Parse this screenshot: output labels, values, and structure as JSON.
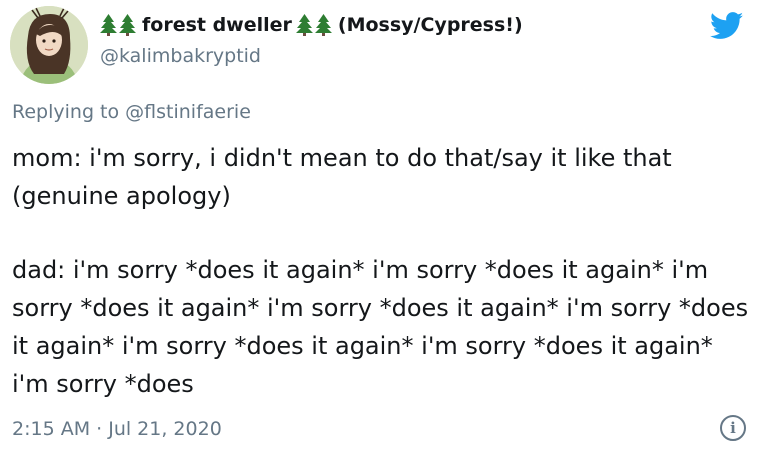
{
  "tweet": {
    "display_name_prefix": "",
    "display_name": "forest dweller",
    "display_name_suffix": "(Mossy/Cypress!)",
    "handle": "@kalimbakryptid",
    "replying_prefix": "Replying to",
    "replying_to": "@flstinifaerie",
    "body_paragraph_1": "mom: i'm sorry, i didn't mean to do that/say it like that (genuine apology)",
    "body_paragraph_2": "dad: i'm sorry *does it again* i'm sorry *does it again* i'm sorry *does it again* i'm sorry *does it again* i'm sorry *does it again* i'm sorry *does it again* i'm sorry *does it again* i'm sorry *does",
    "timestamp": "2:15 AM · Jul 21, 2020",
    "info_glyph": "i"
  },
  "icons": {
    "tree": "evergreen-tree-icon",
    "bird": "twitter-bird-icon",
    "info": "info-icon"
  },
  "colors": {
    "text": "#14171a",
    "secondary": "#657786",
    "twitter_blue": "#1da1f2",
    "tree_green": "#2e7d32"
  }
}
